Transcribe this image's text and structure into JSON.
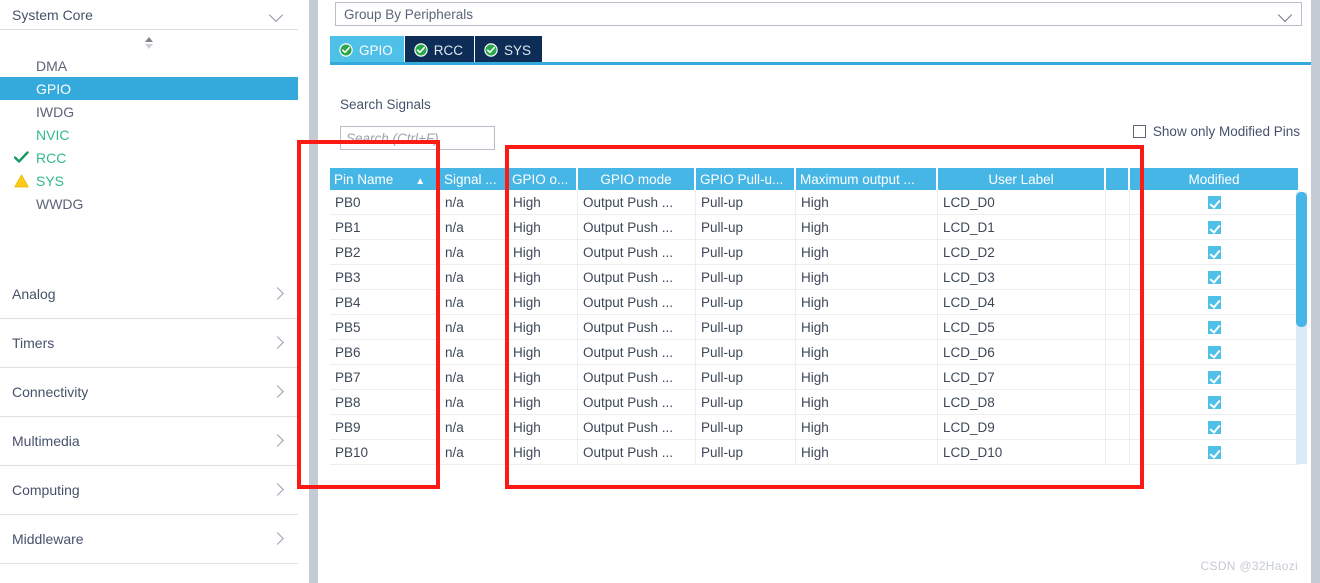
{
  "sidebar": {
    "category_header": {
      "label": "System Core",
      "icon": "chevron-down-icon"
    },
    "peripherals": [
      {
        "label": "DMA",
        "state": "none",
        "icon": ""
      },
      {
        "label": "GPIO",
        "state": "selected",
        "icon": ""
      },
      {
        "label": "IWDG",
        "state": "none",
        "icon": ""
      },
      {
        "label": "NVIC",
        "state": "green",
        "icon": ""
      },
      {
        "label": "RCC",
        "state": "green",
        "icon": "check-icon"
      },
      {
        "label": "SYS",
        "state": "green",
        "icon": "warning-icon"
      },
      {
        "label": "WWDG",
        "state": "none",
        "icon": ""
      }
    ],
    "categories": [
      {
        "label": "Analog",
        "icon": "chevron-right-icon"
      },
      {
        "label": "Timers",
        "icon": "chevron-right-icon"
      },
      {
        "label": "Connectivity",
        "icon": "chevron-right-icon"
      },
      {
        "label": "Multimedia",
        "icon": "chevron-right-icon"
      },
      {
        "label": "Computing",
        "icon": "chevron-right-icon"
      },
      {
        "label": "Middleware",
        "icon": "chevron-right-icon"
      }
    ]
  },
  "main": {
    "group_by": {
      "value": "Group By Peripherals",
      "icon": "chevron-down-icon"
    },
    "tabs": [
      {
        "label": "GPIO",
        "active": true,
        "icon": "check-circle-icon"
      },
      {
        "label": "RCC",
        "active": false,
        "icon": "check-circle-icon"
      },
      {
        "label": "SYS",
        "active": false,
        "icon": "check-circle-icon"
      }
    ],
    "search": {
      "label": "Search Signals",
      "value": "",
      "placeholder": "Search (Ctrl+F)"
    },
    "show_modified": {
      "label": "Show only Modified Pins",
      "checked": false
    },
    "table": {
      "columns": [
        "Pin Name",
        "Signal ...",
        "GPIO o...",
        "GPIO mode",
        "GPIO Pull-u...",
        "Maximum output ...",
        "User Label",
        "",
        "Modified"
      ],
      "sort_column": "Pin Name",
      "sort_indicator": "▲",
      "rows": [
        {
          "pin": "PB0",
          "signal": "n/a",
          "output": "High",
          "mode": "Output Push ...",
          "pull": "Pull-up",
          "speed": "High",
          "label": "LCD_D0",
          "modified": true
        },
        {
          "pin": "PB1",
          "signal": "n/a",
          "output": "High",
          "mode": "Output Push ...",
          "pull": "Pull-up",
          "speed": "High",
          "label": "LCD_D1",
          "modified": true
        },
        {
          "pin": "PB2",
          "signal": "n/a",
          "output": "High",
          "mode": "Output Push ...",
          "pull": "Pull-up",
          "speed": "High",
          "label": "LCD_D2",
          "modified": true
        },
        {
          "pin": "PB3",
          "signal": "n/a",
          "output": "High",
          "mode": "Output Push ...",
          "pull": "Pull-up",
          "speed": "High",
          "label": "LCD_D3",
          "modified": true
        },
        {
          "pin": "PB4",
          "signal": "n/a",
          "output": "High",
          "mode": "Output Push ...",
          "pull": "Pull-up",
          "speed": "High",
          "label": "LCD_D4",
          "modified": true
        },
        {
          "pin": "PB5",
          "signal": "n/a",
          "output": "High",
          "mode": "Output Push ...",
          "pull": "Pull-up",
          "speed": "High",
          "label": "LCD_D5",
          "modified": true
        },
        {
          "pin": "PB6",
          "signal": "n/a",
          "output": "High",
          "mode": "Output Push ...",
          "pull": "Pull-up",
          "speed": "High",
          "label": "LCD_D6",
          "modified": true
        },
        {
          "pin": "PB7",
          "signal": "n/a",
          "output": "High",
          "mode": "Output Push ...",
          "pull": "Pull-up",
          "speed": "High",
          "label": "LCD_D7",
          "modified": true
        },
        {
          "pin": "PB8",
          "signal": "n/a",
          "output": "High",
          "mode": "Output Push ...",
          "pull": "Pull-up",
          "speed": "High",
          "label": "LCD_D8",
          "modified": true
        },
        {
          "pin": "PB9",
          "signal": "n/a",
          "output": "High",
          "mode": "Output Push ...",
          "pull": "Pull-up",
          "speed": "High",
          "label": "LCD_D9",
          "modified": true
        },
        {
          "pin": "PB10",
          "signal": "n/a",
          "output": "High",
          "mode": "Output Push ...",
          "pull": "Pull-up",
          "speed": "High",
          "label": "LCD_D10",
          "modified": true
        }
      ]
    }
  },
  "annotations": {
    "boxes": [
      {
        "name": "pin-name-column-highlight"
      },
      {
        "name": "pin-config-columns-highlight"
      }
    ],
    "color": "#fc1b14"
  },
  "watermark": "CSDN @32Haozi",
  "colors": {
    "accent_blue": "#34aadc",
    "header_blue": "#45b6e5",
    "tab_dark": "#0d2d56",
    "green": "#2fbb8c",
    "annotation_red": "#fc1b14"
  }
}
